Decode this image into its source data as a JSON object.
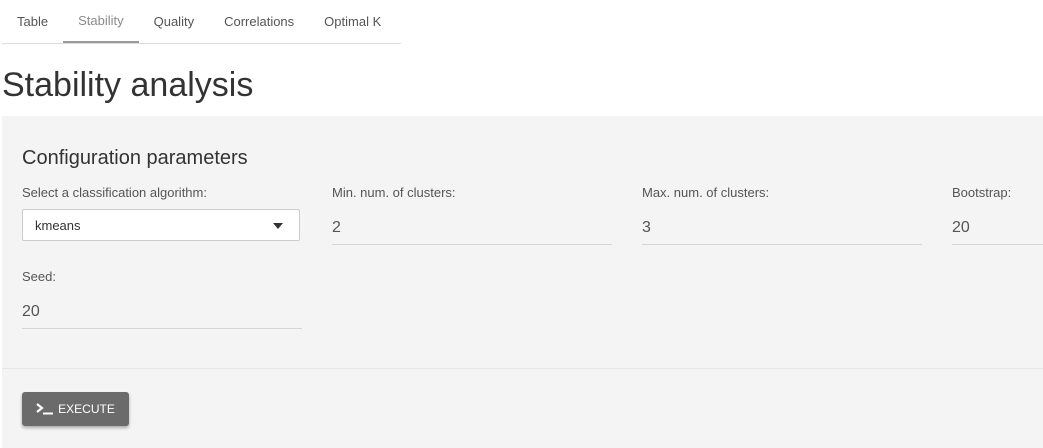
{
  "tabs": [
    {
      "label": "Table",
      "active": false
    },
    {
      "label": "Stability",
      "active": true
    },
    {
      "label": "Quality",
      "active": false
    },
    {
      "label": "Correlations",
      "active": false
    },
    {
      "label": "Optimal K",
      "active": false
    }
  ],
  "page_title": "Stability analysis",
  "config": {
    "title": "Configuration parameters",
    "algorithm": {
      "label": "Select a classification algorithm:",
      "value": "kmeans"
    },
    "min_clusters": {
      "label": "Min. num. of clusters:",
      "value": "2"
    },
    "max_clusters": {
      "label": "Max. num. of clusters:",
      "value": "3"
    },
    "bootstrap": {
      "label": "Bootstrap:",
      "value": "20"
    },
    "seed": {
      "label": "Seed:",
      "value": "20"
    }
  },
  "execute": {
    "label": "EXECUTE",
    "icon": "terminal-icon"
  },
  "colors": {
    "button_bg": "#6b6b6b",
    "panel_bg": "#f4f4f4",
    "active_tab_underline": "#9a9a9a"
  }
}
